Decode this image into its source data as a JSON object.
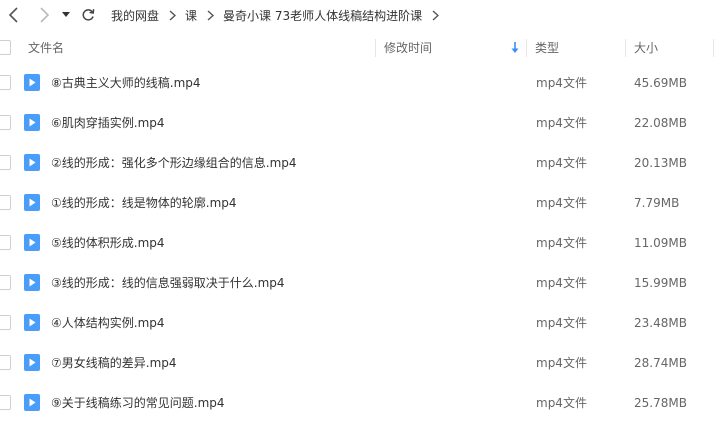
{
  "breadcrumb": [
    "我的网盘",
    "课",
    "曼奇小课 73老师人体线稿结构进阶课"
  ],
  "columns": {
    "name": "文件名",
    "modified": "修改时间",
    "type": "类型",
    "size": "大小"
  },
  "colors": {
    "accent": "#3b8cf5",
    "video_icon": "#4a9df8"
  },
  "files": [
    {
      "name": "⑧古典主义大师的线稿.mp4",
      "type": "mp4文件",
      "size": "45.69MB"
    },
    {
      "name": "⑥肌肉穿插实例.mp4",
      "type": "mp4文件",
      "size": "22.08MB"
    },
    {
      "name": "②线的形成：强化多个形边缘组合的信息.mp4",
      "type": "mp4文件",
      "size": "20.13MB"
    },
    {
      "name": "①线的形成：线是物体的轮廓.mp4",
      "type": "mp4文件",
      "size": "7.79MB"
    },
    {
      "name": "⑤线的体积形成.mp4",
      "type": "mp4文件",
      "size": "11.09MB"
    },
    {
      "name": "③线的形成：线的信息强弱取决于什么.mp4",
      "type": "mp4文件",
      "size": "15.99MB"
    },
    {
      "name": "④人体结构实例.mp4",
      "type": "mp4文件",
      "size": "23.48MB"
    },
    {
      "name": "⑦男女线稿的差异.mp4",
      "type": "mp4文件",
      "size": "28.74MB"
    },
    {
      "name": "⑨关于线稿练习的常见问题.mp4",
      "type": "mp4文件",
      "size": "25.78MB"
    }
  ]
}
